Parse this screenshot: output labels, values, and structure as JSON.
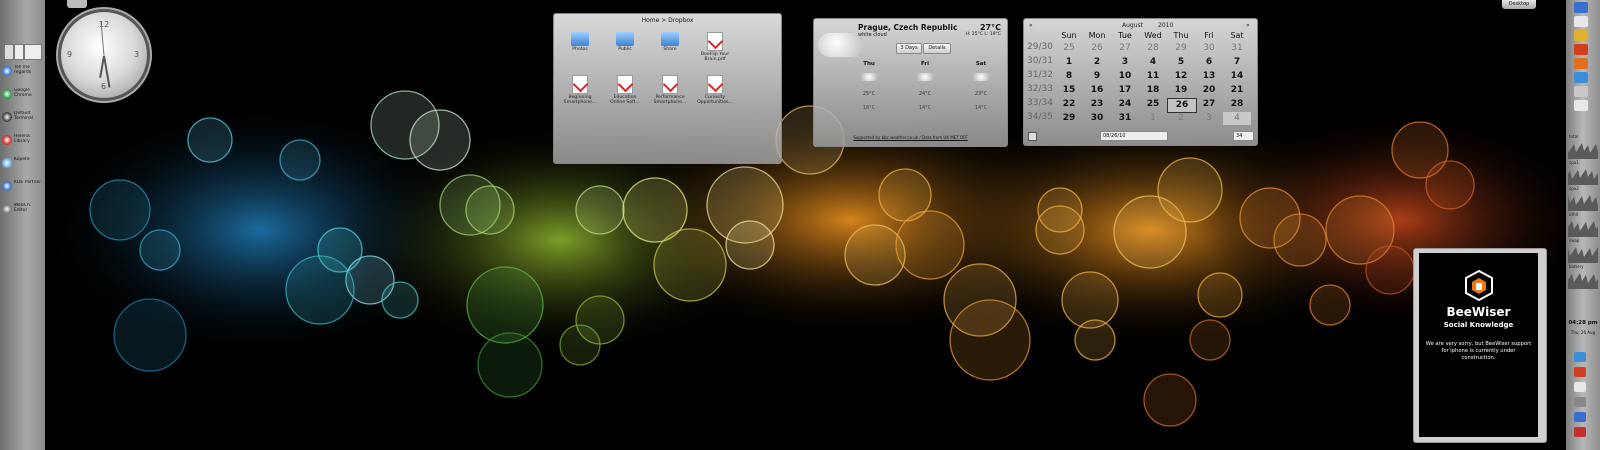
{
  "colors": {
    "accent_blue": "#3b82d6",
    "panel_grey": "#a9a9a9",
    "bubble_orange": "#f0a030",
    "bubble_blue": "#2aa7c9",
    "bubble_green": "#7fb63a"
  },
  "clock": {
    "numerals": [
      "12",
      "3",
      "6",
      "9"
    ]
  },
  "taskbar": {
    "items": [
      {
        "label": "Tell me regards",
        "icon": "chrome-icon"
      },
      {
        "label": "Google Chrome",
        "icon": "chrome-icon"
      },
      {
        "label": "Default Terminal",
        "icon": "terminal-icon"
      },
      {
        "label": "Helena Library",
        "icon": "library-icon"
      },
      {
        "label": "Kopete",
        "icon": "kopete-icon"
      },
      {
        "label": "KDE Partner",
        "icon": "kde-icon"
      },
      {
        "label": "WebCh. Editor",
        "icon": "web-icon"
      }
    ]
  },
  "folder": {
    "breadcrumb": "Home > Dropbox",
    "items": [
      {
        "label": "Photos",
        "kind": "folder"
      },
      {
        "label": "Public",
        "kind": "folder"
      },
      {
        "label": "Share",
        "kind": "folder"
      },
      {
        "label": "BeeFlip Your Brain.pdf",
        "kind": "pdf"
      },
      {
        "label": "Beginning Smartphone...",
        "kind": "pdf"
      },
      {
        "label": "Education Online Soft...",
        "kind": "pdf"
      },
      {
        "label": "Performance Smartphone...",
        "kind": "pdf"
      },
      {
        "label": "Curiosity Opportunities...",
        "kind": "pdf"
      }
    ]
  },
  "weather": {
    "location": "Prague, Czech Republic",
    "condition": "white cloud",
    "temp": "27°C",
    "range": "H: 25°C L: 19°C",
    "tab_days": "3 Days",
    "tab_details": "Details",
    "days": [
      {
        "name": "Thu",
        "high": "25°C",
        "low": "16°C"
      },
      {
        "name": "Fri",
        "high": "24°C",
        "low": "14°C"
      },
      {
        "name": "Sat",
        "high": "23°C",
        "low": "14°C"
      }
    ],
    "footer": "Supported by bbc.weather.co.uk / Data from UK MET OFF"
  },
  "calendar": {
    "month": "August",
    "year": "2010",
    "prev": "«",
    "next": "»",
    "weekdays": [
      "Sun",
      "Mon",
      "Tue",
      "Wed",
      "Thu",
      "Fri",
      "Sat"
    ],
    "weeks": [
      {
        "wk": "29/30",
        "days": [
          "25",
          "26",
          "27",
          "28",
          "29",
          "30",
          "31"
        ],
        "other": [
          true,
          true,
          true,
          true,
          true,
          true,
          true
        ]
      },
      {
        "wk": "30/31",
        "days": [
          "1",
          "2",
          "3",
          "4",
          "5",
          "6",
          "7"
        ],
        "other": [
          false,
          false,
          false,
          false,
          false,
          false,
          false
        ]
      },
      {
        "wk": "31/32",
        "days": [
          "8",
          "9",
          "10",
          "11",
          "12",
          "13",
          "14"
        ],
        "other": [
          false,
          false,
          false,
          false,
          false,
          false,
          false
        ]
      },
      {
        "wk": "32/33",
        "days": [
          "15",
          "16",
          "17",
          "18",
          "19",
          "20",
          "21"
        ],
        "other": [
          false,
          false,
          false,
          false,
          false,
          false,
          false
        ]
      },
      {
        "wk": "33/34",
        "days": [
          "22",
          "23",
          "24",
          "25",
          "26",
          "27",
          "28"
        ],
        "other": [
          false,
          false,
          false,
          false,
          false,
          false,
          false
        ]
      },
      {
        "wk": "34/35",
        "days": [
          "29",
          "30",
          "31",
          "1",
          "2",
          "3",
          "4"
        ],
        "other": [
          false,
          false,
          false,
          true,
          true,
          true,
          true
        ]
      }
    ],
    "selected": "26",
    "date_input": "08/26/10",
    "week_spin": "34"
  },
  "beewiser": {
    "title": "BeeWiser",
    "subtitle": "Social Knowledge",
    "message": "We are very sorry, but BeeWiser support for iphone is currently under construction."
  },
  "right_panel": {
    "graph_labels": [
      "total",
      "cpu1",
      "cpu2",
      "eth0",
      "swap",
      "battery"
    ],
    "time": "04:28 pm",
    "date": "Thu, 26 Aug"
  },
  "desktop_button": "Desktop"
}
